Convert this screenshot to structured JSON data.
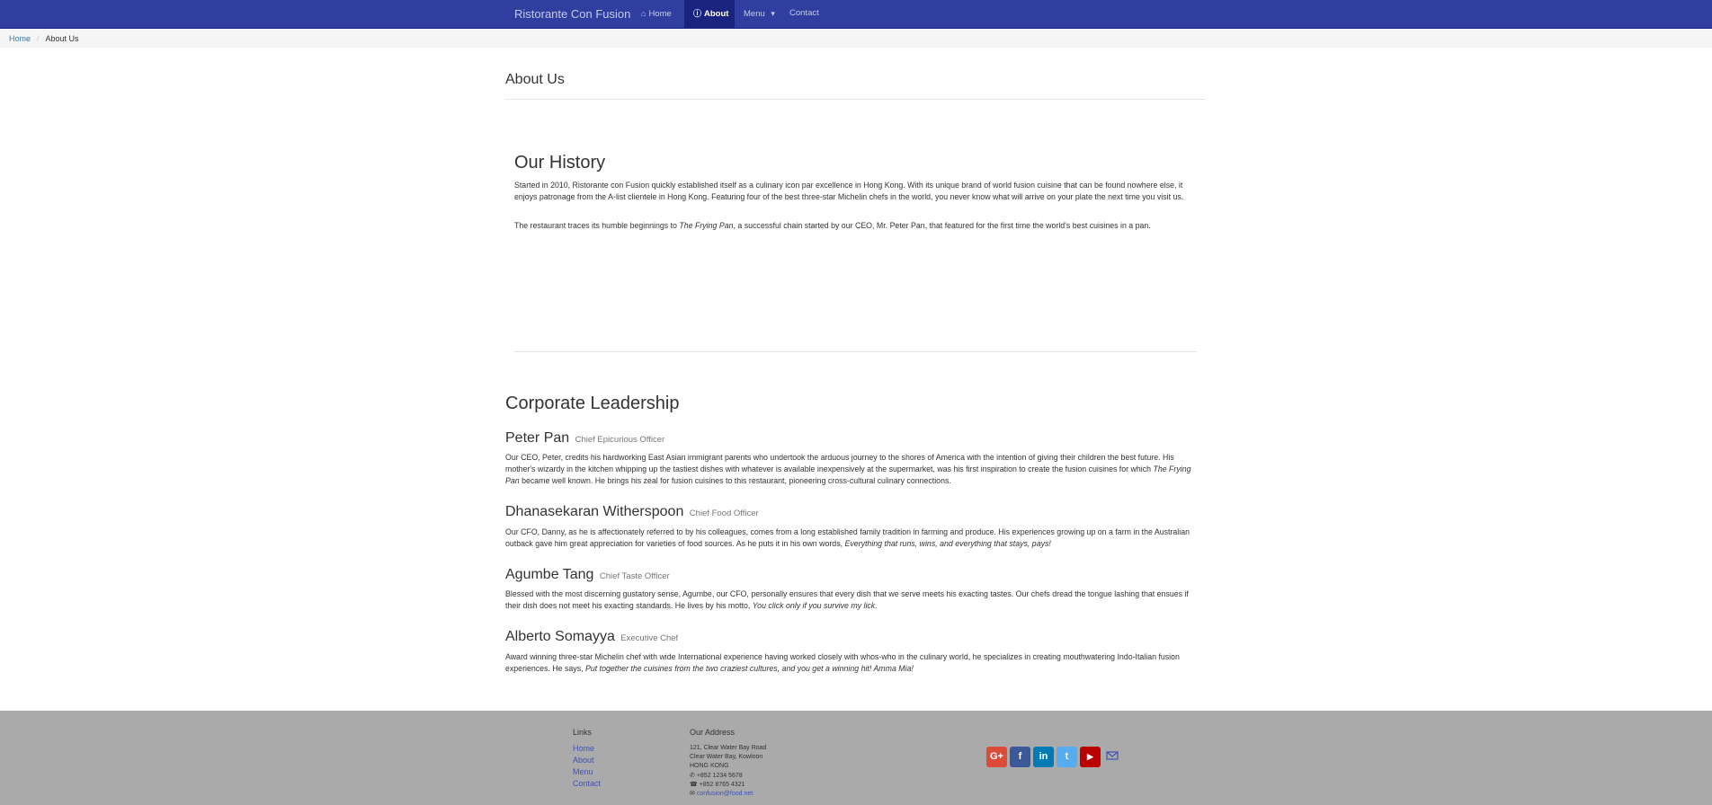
{
  "navbar": {
    "brand": "Ristorante Con Fusion",
    "items": [
      {
        "label": "Home",
        "icon": "home-icon"
      },
      {
        "label": "About",
        "icon": "info-circle-icon"
      },
      {
        "label": "Menu",
        "icon": "caret-down-icon"
      },
      {
        "label": "Contact"
      }
    ],
    "active": "About",
    "colors": {
      "bar": "#303f9f",
      "active": "#1a237e"
    }
  },
  "breadcrumb": {
    "home": "Home",
    "current": "About Us"
  },
  "page": {
    "title": "About Us"
  },
  "history": {
    "title": "Our History",
    "p1": "Started in 2010, Ristorante con Fusion quickly established itself as a culinary icon par excellence in Hong Kong. With its unique brand of world fusion cuisine that can be found nowhere else, it enjoys patronage from the A-list clientele in Hong Kong. Featuring four of the best three-star Michelin chefs in the world, you never know what will arrive on your plate the next time you visit us.",
    "p2_before": "The restaurant traces its humble beginnings to ",
    "p2_em": "The Frying Pan",
    "p2_after": ", a successful chain started by our CEO, Mr. Peter Pan, that featured for the first time the world's best cuisines in a pan."
  },
  "leadership": {
    "title": "Corporate Leadership",
    "leaders": [
      {
        "name": "Peter Pan",
        "role": "Chief Epicurious Officer",
        "before": "Our CEO, Peter, credits his hardworking East Asian immigrant parents who undertook the arduous journey to the shores of America with the intention of giving their children the best future. His mother's wizardy in the kitchen whipping up the tastiest dishes with whatever is available inexpensively at the supermarket, was his first inspiration to create the fusion cuisines for which ",
        "em": "The Frying Pan",
        "after": " became well known. He brings his zeal for fusion cuisines to this restaurant, pioneering cross-cultural culinary connections."
      },
      {
        "name": "Dhanasekaran Witherspoon",
        "role": "Chief Food Officer",
        "before": "Our CFO, Danny, as he is affectionately referred to by his colleagues, comes from a long established family tradition in farming and produce. His experiences growing up on a farm in the Australian outback gave him great appreciation for varieties of food sources. As he puts it in his own words, ",
        "em": "Everything that runs, wins, and everything that stays, pays!",
        "after": ""
      },
      {
        "name": "Agumbe Tang",
        "role": "Chief Taste Officer",
        "before": "Blessed with the most discerning gustatory sense, Agumbe, our CFO, personally ensures that every dish that we serve meets his exacting tastes. Our chefs dread the tongue lashing that ensues if their dish does not meet his exacting standards. He lives by his motto, ",
        "em": "You click only if you survive my lick.",
        "after": ""
      },
      {
        "name": "Alberto Somayya",
        "role": "Executive Chef",
        "before": "Award winning three-star Michelin chef with wide International experience having worked closely with whos-who in the culinary world, he specializes in creating mouthwatering Indo-Italian fusion experiences. He says, ",
        "em": "Put together the cuisines from the two craziest cultures, and you get a winning hit! Amma Mia!",
        "after": ""
      }
    ]
  },
  "footer": {
    "links_title": "Links",
    "links": [
      "Home",
      "About",
      "Menu",
      "Contact"
    ],
    "address_title": "Our Address",
    "address": [
      "121, Clear Water Bay Road",
      "Clear Water Bay, Kowloon",
      "HONG KONG"
    ],
    "phone": "+852 1234 5678",
    "fax": "+852 8765 4321",
    "email": "confusion@food.net",
    "social": [
      {
        "icon": "google-plus-icon",
        "glyph": "G+",
        "color": "#dd4b39"
      },
      {
        "icon": "facebook-icon",
        "glyph": "f",
        "color": "#3b5998"
      },
      {
        "icon": "linkedin-icon",
        "glyph": "in",
        "color": "#007bb6"
      },
      {
        "icon": "twitter-icon",
        "glyph": "t",
        "color": "#55acee"
      },
      {
        "icon": "youtube-icon",
        "glyph": "▶",
        "color": "#bb0000"
      }
    ]
  }
}
